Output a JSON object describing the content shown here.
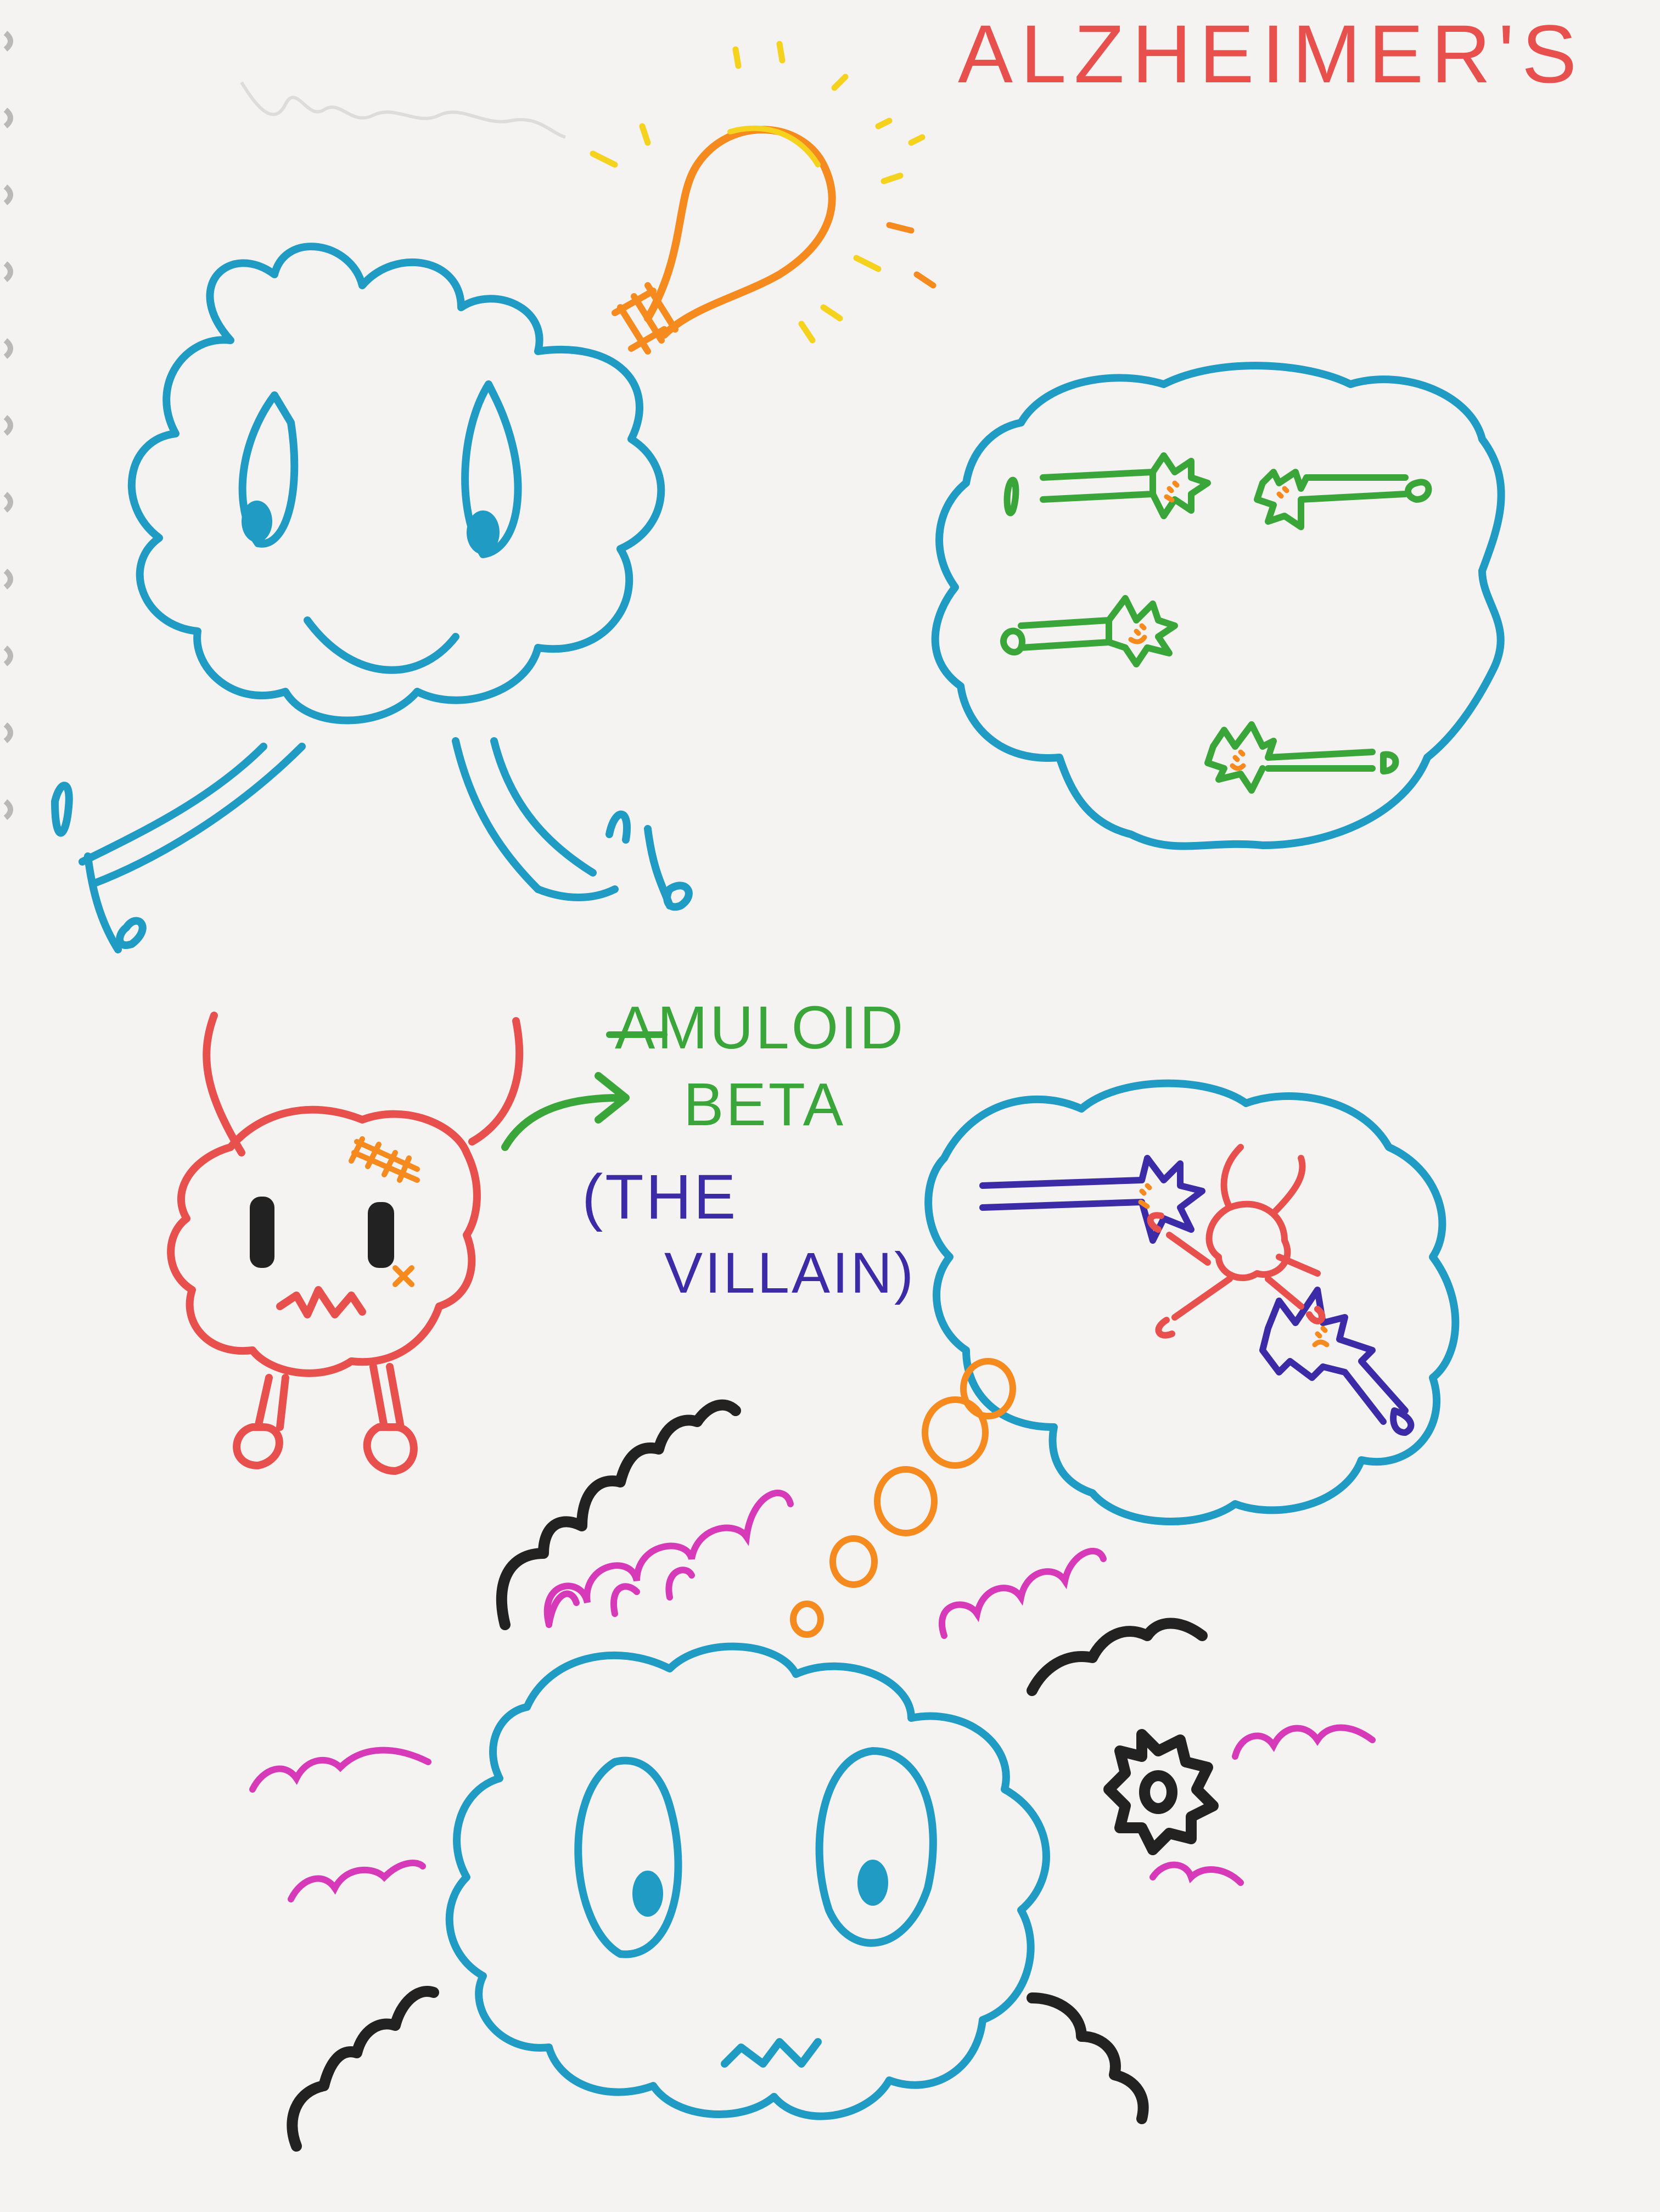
{
  "title": "ALZHEIMER'S",
  "labels": {
    "line1": "AMULOID",
    "line2": "BETA",
    "line3": "(THE",
    "line4": "VILLAIN)"
  },
  "colors": {
    "paper": "#f4f3f1",
    "ink_blue": "#1f9bc4",
    "ink_red": "#e8504d",
    "ink_green": "#3aa63a",
    "ink_purple": "#3b2ba6",
    "ink_orange": "#f58a1f",
    "ink_yellow": "#f4d21e",
    "ink_magenta": "#d63ab8",
    "ink_black": "#222222"
  },
  "figures": [
    "happy-brain-with-lightbulb",
    "healthy-neurons-cloud",
    "amyloid-beta-villain",
    "damaged-neurons-cloud",
    "confused-brain"
  ]
}
